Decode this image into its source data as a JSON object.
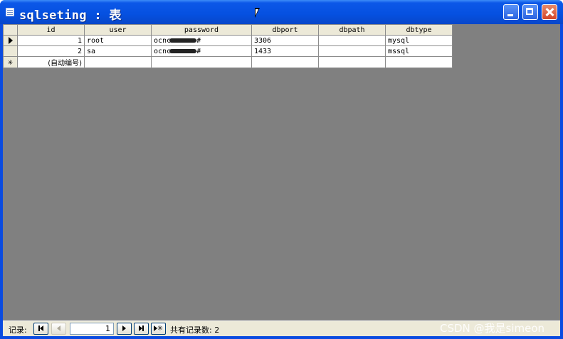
{
  "window": {
    "title": "sqlseting : 表"
  },
  "grid": {
    "columns": [
      "id",
      "user",
      "password",
      "dbport",
      "dbpath",
      "dbtype"
    ],
    "rows": [
      {
        "id": "1",
        "user": "root",
        "password": "ocnc",
        "password_tail": "#",
        "dbport": "3306",
        "dbpath": "",
        "dbtype": "mysql"
      },
      {
        "id": "2",
        "user": "sa",
        "password": "ocnc",
        "password_tail": "#",
        "dbport": "1433",
        "dbpath": "",
        "dbtype": "mssql"
      }
    ],
    "new_row_id": "(自动编号)"
  },
  "navigator": {
    "label": "记录:",
    "current_record": "1",
    "count_text": "共有记录数: 2"
  },
  "watermark": "CSDN @我是simeon"
}
